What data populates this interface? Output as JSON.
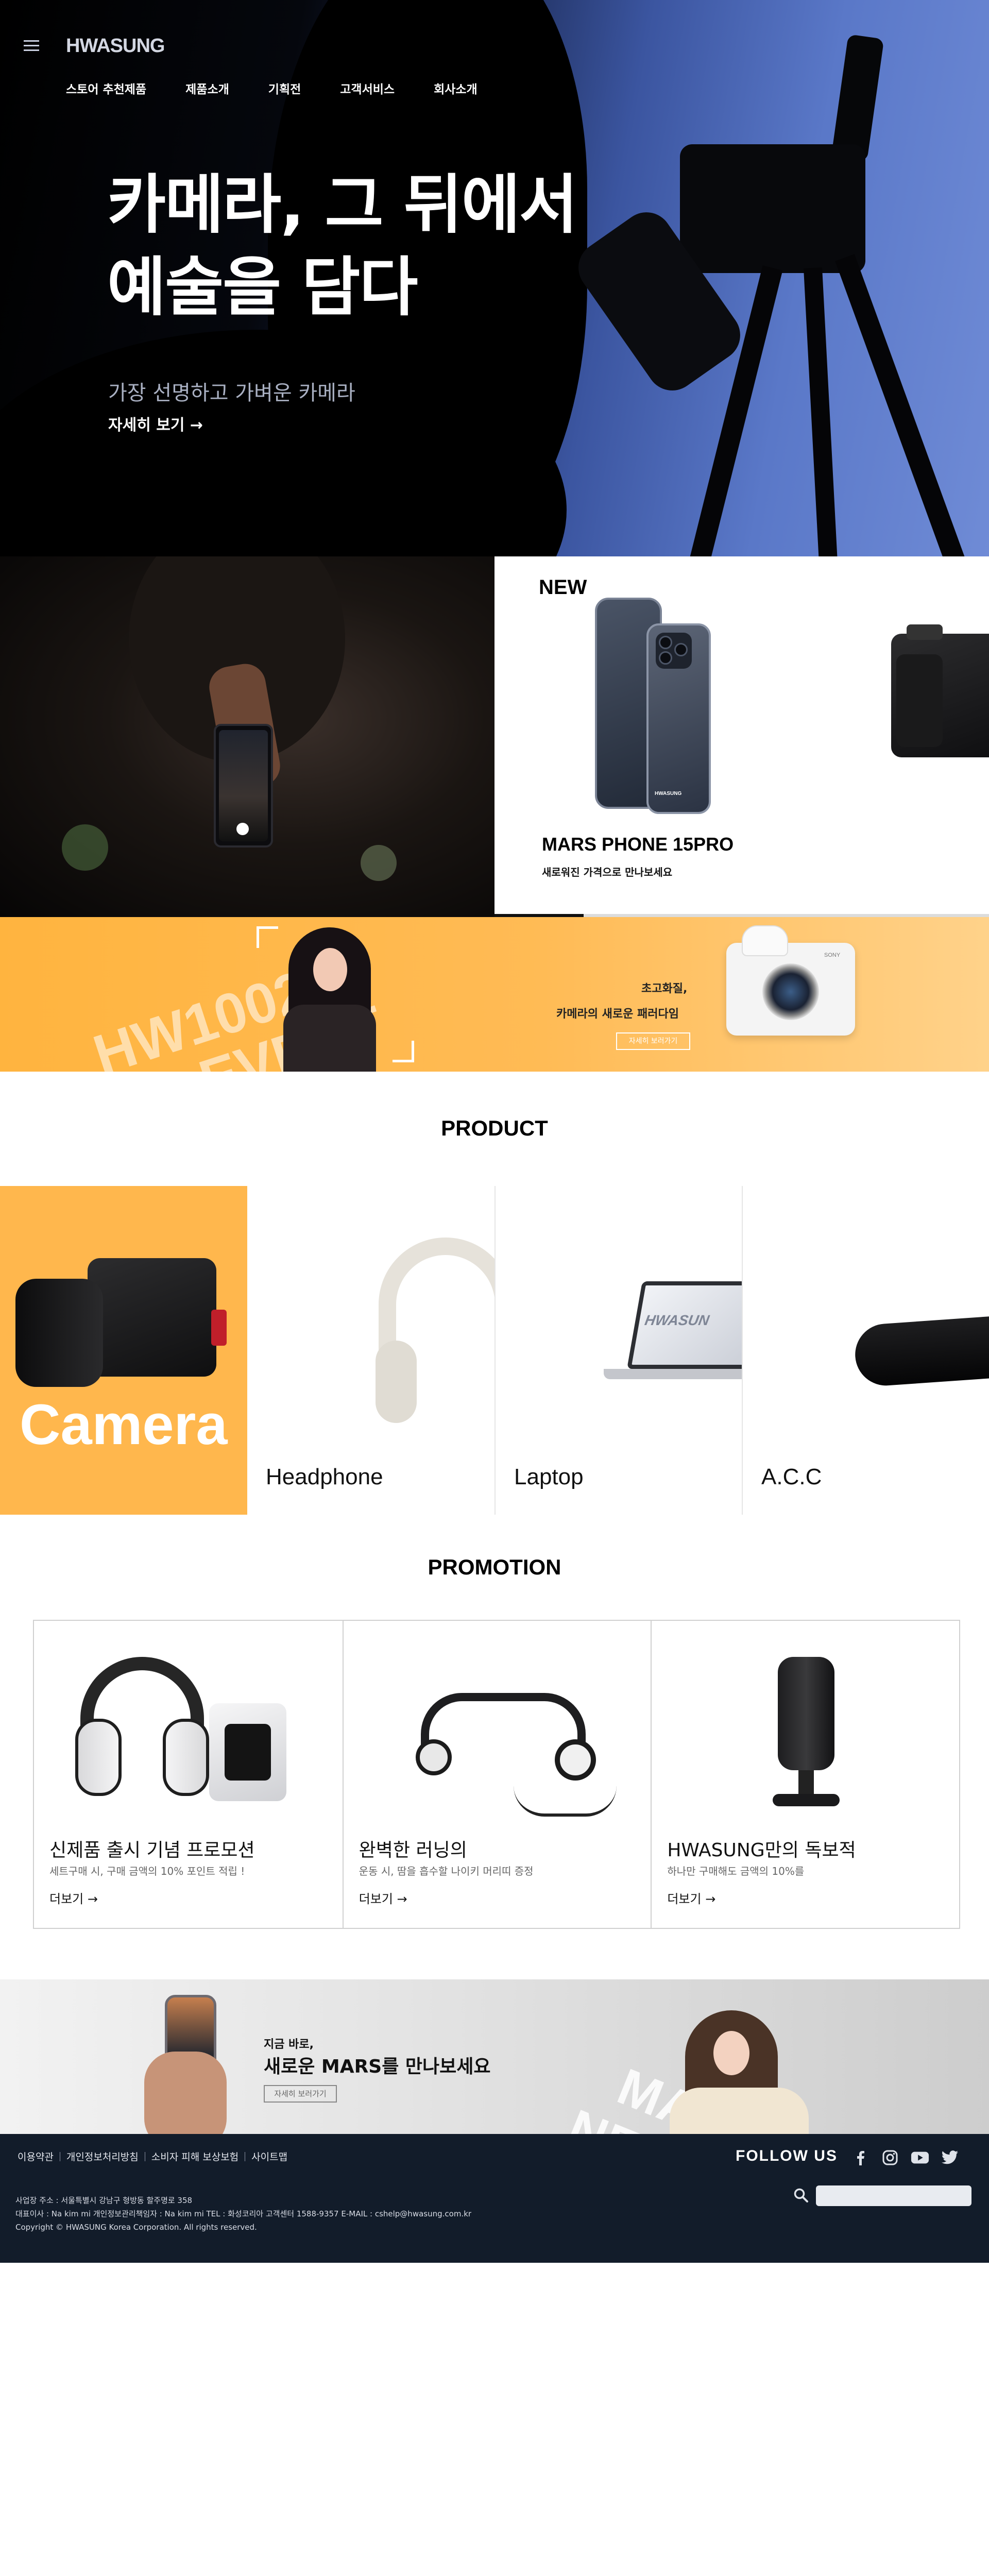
{
  "header": {
    "logo": "HWASUNG",
    "nav": [
      "스토어 추천제품",
      "제품소개",
      "기획전",
      "고객서비스",
      "회사소개"
    ]
  },
  "hero": {
    "title_line1": "카메라, 그 뒤에서",
    "title_line2": "예술을 담다",
    "subtitle": "가장 선명하고 가벼운 카메라",
    "more": "자세히 보기 →"
  },
  "new_product": {
    "badge": "NEW",
    "phone_brand": "HWASUNG",
    "name": "MARS PHONE 15PRO",
    "description": "새로워진 가격으로 만나보세요",
    "slider_progress": 0.18
  },
  "event_banner": {
    "bg_text_line1": "HW1002",
    "bg_text_line2": "EVENT",
    "title_line1": "초고화질,",
    "title_line2": "카메라의 새로운 패러다임",
    "button": "자세히 보러가기",
    "camera_brand": "SONY"
  },
  "product_section": {
    "title": "PRODUCT",
    "items": [
      {
        "label": "Camera"
      },
      {
        "label": "Headphone"
      },
      {
        "label": "Laptop",
        "screen_logo": "HWASUN"
      },
      {
        "label": "A.C.C"
      }
    ]
  },
  "promotion_section": {
    "title": "PROMOTION",
    "items": [
      {
        "title": "신제품 출시 기념 프로모션",
        "desc": "세트구매 시, 구매 금액의 10% 포인트 적립 !",
        "more": "더보기 →"
      },
      {
        "title": "완벽한 러닝의",
        "desc": "운동 시, 땀을 흡수할 나이키 머리띠 증정",
        "more": "더보기 →"
      },
      {
        "title": "HWASUNG만의 독보적",
        "desc": "하나만 구매해도 금액의 10%를",
        "more": "더보기 →"
      }
    ]
  },
  "mars_banner": {
    "small": "지금 바로,",
    "big": "새로운 MARS를 만나보세요",
    "button": "자세히 보러가기",
    "bg_text_line1": "MARS PHONE",
    "bg_text_line2": "NEW EVENT"
  },
  "footer": {
    "links": [
      "이용약관",
      "개인정보처리방침",
      "소비자 피해 보상보험",
      "사이트맵"
    ],
    "follow": "FOLLOW US",
    "socials": [
      "facebook-icon",
      "instagram-icon",
      "youtube-icon",
      "twitter-icon"
    ],
    "search_placeholder": "",
    "info_line1": "사업장 주소 : 서울특별시 강남구 형방동 할주명로 358",
    "info_line2": "대표이사 : Na kim mi   개인정보관리책임자 : Na kim mi   TEL : 화성코리아 고객센터 1588-9357 E-MAIL : cshelp@hwasung.com.kr",
    "info_line3": "Copyright © HWASUNG Korea Corporation.  All rights reserved."
  }
}
